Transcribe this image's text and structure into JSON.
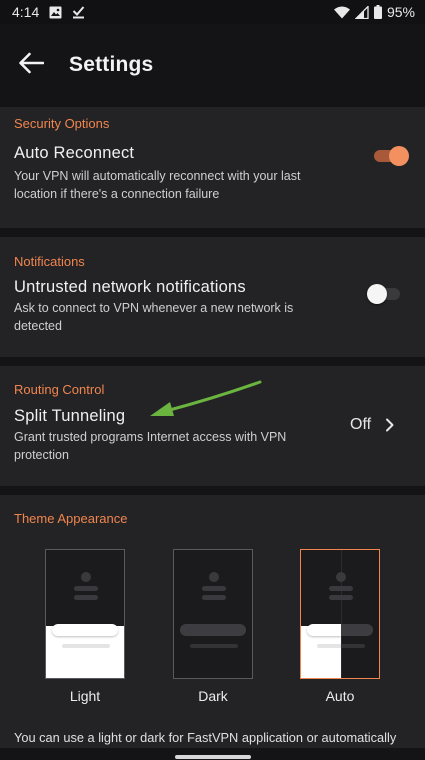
{
  "status_bar": {
    "time": "4:14",
    "battery": "95%",
    "icons": [
      "image-icon",
      "download-done-icon",
      "wifi-icon",
      "signal-icon",
      "battery-icon"
    ]
  },
  "header": {
    "title": "Settings",
    "back_icon": "arrow-left-icon"
  },
  "security": {
    "section": "Security Options",
    "title": "Auto Reconnect",
    "desc_line1": "Your VPN will automatically reconnect with your last",
    "desc_line2": "location if there's a connection failure",
    "enabled": true
  },
  "notifications": {
    "section": "Notifications",
    "title": "Untrusted network notifications",
    "desc_line1": "Ask to connect to VPN whenever a new network is",
    "desc_line2": "detected",
    "enabled": false
  },
  "routing": {
    "section": "Routing Control",
    "title": "Split Tunneling",
    "desc_line1": "Grant trusted programs Internet access with VPN",
    "desc_line2": "protection",
    "value": "Off"
  },
  "theme": {
    "section": "Theme Appearance",
    "options": [
      {
        "label": "Light",
        "selected": false
      },
      {
        "label": "Dark",
        "selected": false
      },
      {
        "label": "Auto",
        "selected": true
      }
    ],
    "footer": "You can use a light or dark for FastVPN application or automatically"
  },
  "colors": {
    "accent": "#f0854d",
    "annotation_arrow": "#6ab43f",
    "card_bg": "#232326",
    "page_bg": "#141416"
  }
}
